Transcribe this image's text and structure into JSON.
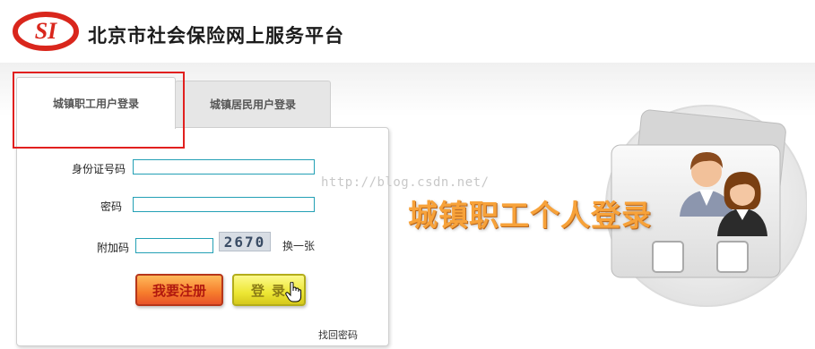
{
  "header": {
    "logo_text": "SI",
    "title": "北京市社会保险网上服务平台"
  },
  "tabs": [
    {
      "label": "城镇职工用户登录",
      "active": true
    },
    {
      "label": "城镇居民用户登录",
      "active": false
    }
  ],
  "form": {
    "id_label": "身份证号码",
    "id_value": "",
    "password_label": "密码",
    "password_value": "",
    "captcha_label": "附加码",
    "captcha_value": "",
    "captcha_image_text": "2670",
    "refresh_label": "换一张",
    "register_button": "我要注册",
    "login_button": "登录",
    "forgot_password": "找回密码"
  },
  "watermark": "http://blog.csdn.net/",
  "promo": {
    "title": "城镇职工个人登录"
  },
  "colors": {
    "highlight": "#e1201f",
    "input_border": "#23a0b5",
    "register_button": "#f67c2c",
    "login_button": "#ede734",
    "promo_text": "#f7a23a",
    "logo_red": "#d9261c"
  }
}
